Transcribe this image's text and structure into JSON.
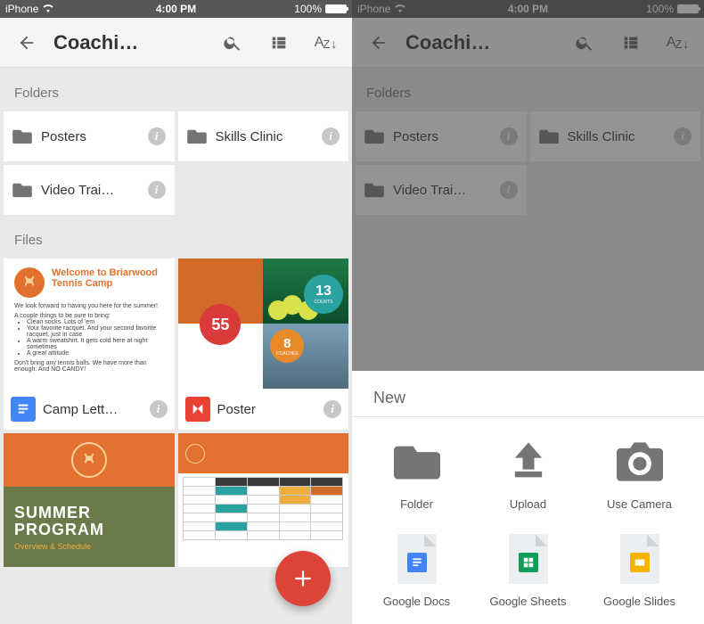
{
  "statusbar": {
    "carrier": "iPhone",
    "time": "4:00 PM",
    "battery_pct": "100%"
  },
  "appbar": {
    "title": "Coachi…"
  },
  "sections": {
    "folders": "Folders",
    "files": "Files"
  },
  "folders": [
    {
      "name": "Posters"
    },
    {
      "name": "Skills Clinic"
    },
    {
      "name": "Video Trai…"
    }
  ],
  "files": [
    {
      "name": "Camp Lett…",
      "type": "doc",
      "thumb": {
        "title": "Welcome to Briarwood Tennis Camp"
      }
    },
    {
      "name": "Poster",
      "type": "slides",
      "thumb": {
        "b1_num": "13",
        "b1_sub": "COURTS",
        "b2_num": "8",
        "b2_sub": "COACHES",
        "b3_num": "55"
      }
    },
    {
      "name": "",
      "type": "slides",
      "thumb": {
        "h1": "SUMMER",
        "h2": "PROGRAM",
        "sub": "Overview & Schedule"
      }
    },
    {
      "name": "",
      "type": "sheet"
    }
  ],
  "sheet": {
    "title": "New",
    "items": [
      {
        "label": "Folder"
      },
      {
        "label": "Upload"
      },
      {
        "label": "Use Camera"
      },
      {
        "label": "Google Docs"
      },
      {
        "label": "Google Sheets"
      },
      {
        "label": "Google Slides"
      }
    ]
  }
}
